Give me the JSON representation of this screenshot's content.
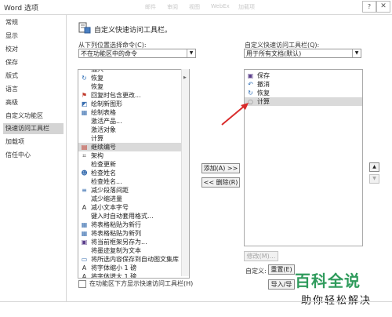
{
  "window": {
    "title": "Word 选项",
    "close_glyph": "✕",
    "help_glyph": "?"
  },
  "ghost_tabs": [
    "邮件",
    "审阅",
    "视图",
    "WebEx",
    "加载项"
  ],
  "sidebar": {
    "items": [
      {
        "label": "常规",
        "selected": false
      },
      {
        "label": "显示",
        "selected": false
      },
      {
        "label": "校对",
        "selected": false
      },
      {
        "label": "保存",
        "selected": false
      },
      {
        "label": "版式",
        "selected": false
      },
      {
        "label": "语言",
        "selected": false
      },
      {
        "label": "高级",
        "selected": false
      },
      {
        "label": "自定义功能区",
        "selected": false
      },
      {
        "label": "快速访问工具栏",
        "selected": true
      },
      {
        "label": "加载项",
        "selected": false
      },
      {
        "label": "信任中心",
        "selected": false
      }
    ]
  },
  "main": {
    "heading": "自定义快速访问工具栏。",
    "left": {
      "choose_label": "从下列位置选择命令(C):",
      "choose_value": "不在功能区中的命令",
      "commands": [
        {
          "icon": "",
          "label": "插入"
        },
        {
          "icon": "redo-icon",
          "label": "恢复"
        },
        {
          "icon": "",
          "label": "恢复"
        },
        {
          "icon": "flag-icon",
          "label": "回复时包含更改..."
        },
        {
          "icon": "shape-icon",
          "label": "绘制新图形"
        },
        {
          "icon": "table-icon",
          "label": "绘制表格"
        },
        {
          "icon": "",
          "label": "激活产品..."
        },
        {
          "icon": "",
          "label": "激活对象"
        },
        {
          "icon": "",
          "label": "计算"
        },
        {
          "icon": "calendar-icon",
          "label": "继续编号"
        },
        {
          "icon": "crop-icon",
          "label": "架构"
        },
        {
          "icon": "",
          "label": "检查更新"
        },
        {
          "icon": "person-icon",
          "label": "检查姓名"
        },
        {
          "icon": "",
          "label": "检查姓名..."
        },
        {
          "icon": "indent-icon",
          "label": "减少段落间距"
        },
        {
          "icon": "",
          "label": "减少缩进量"
        },
        {
          "icon": "font-icon",
          "label": "减小文本字号"
        },
        {
          "icon": "",
          "label": "键入时自动套用格式..."
        },
        {
          "icon": "table-icon",
          "label": "将表格粘贴为新行"
        },
        {
          "icon": "table-icon",
          "label": "将表格粘贴为新列"
        },
        {
          "icon": "save-icon",
          "label": "将当前框架另存为..."
        },
        {
          "icon": "",
          "label": "将墨迹复制为文本"
        },
        {
          "icon": "doc-icon",
          "label": "将所选内容保存到自动图文集库"
        },
        {
          "icon": "font-icon",
          "label": "将字体缩小 1 磅"
        },
        {
          "icon": "font-icon",
          "label": "将字体增大 1 磅"
        }
      ],
      "selected_index": 9,
      "show_below_label": "在功能区下方显示快速访问工具栏(H)"
    },
    "buttons": {
      "add": "添加(A) >>",
      "remove": "<< 删除(R)"
    },
    "right": {
      "customize_label": "自定义快速访问工具栏(Q):",
      "customize_value": "用于所有文档(默认)",
      "commands": [
        {
          "icon": "save-icon",
          "label": "保存"
        },
        {
          "icon": "undo-icon",
          "label": "撤消"
        },
        {
          "icon": "redo-icon",
          "label": "恢复"
        },
        {
          "icon": "circle-icon",
          "label": "计算"
        }
      ],
      "selected_index": 3,
      "modify_label": "修改(M)...",
      "customizations_label": "自定义:",
      "reset_label": "重置(E)",
      "import_label": "导入/导"
    }
  },
  "watermark": {
    "main": "百科全说",
    "sub": "助你轻松解决"
  },
  "colors": {
    "accent_green": "#2f9b5c",
    "arrow_red": "#d92b2b",
    "selection": "#dadada"
  }
}
